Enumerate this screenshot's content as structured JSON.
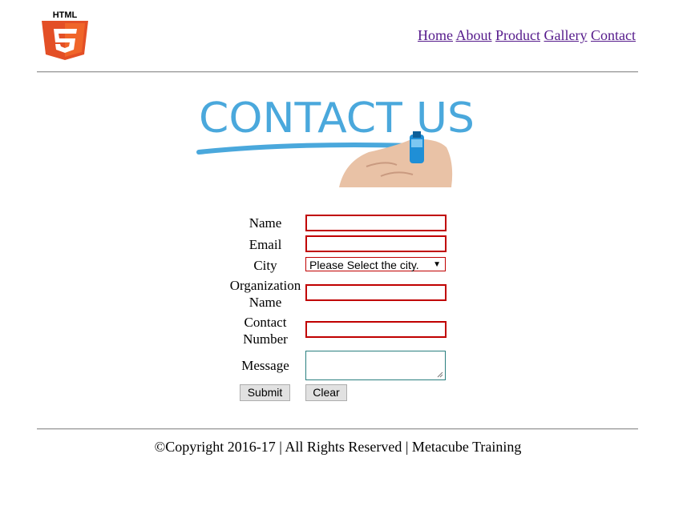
{
  "logo": {
    "text": "HTML",
    "digit": "5"
  },
  "nav": {
    "items": [
      "Home",
      "About",
      "Product",
      "Gallery",
      "Contact"
    ]
  },
  "banner": {
    "text": "CONTACT US"
  },
  "form": {
    "name_label": "Name",
    "email_label": "Email",
    "city_label": "City",
    "org_label_line1": "Organization",
    "org_label_line2": "Name",
    "contact_label_line1": "Contact",
    "contact_label_line2": "Number",
    "message_label": "Message",
    "city_selected": "Please Select the city.",
    "submit_label": "Submit",
    "clear_label": "Clear"
  },
  "colors": {
    "invalid_border": "#c00000",
    "link": "#551a8b",
    "banner_blue": "#4aa8dc",
    "html5_orange": "#e34f26"
  },
  "footer": {
    "text": "©Copyright 2016-17 | All Rights Reserved | Metacube Training"
  }
}
